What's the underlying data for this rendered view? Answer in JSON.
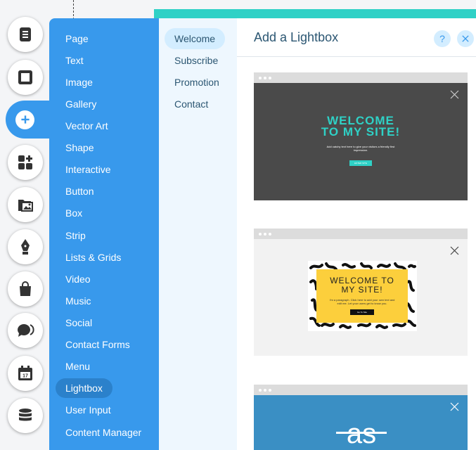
{
  "colors": {
    "accent": "#3899ec",
    "active_item": "#2b81cb",
    "teal": "#2fd1c6",
    "text_dark": "#2b5672"
  },
  "rail": {
    "items": [
      {
        "icon": "pages-icon"
      },
      {
        "icon": "background-icon"
      },
      {
        "icon": "add-icon",
        "active": true
      },
      {
        "icon": "app-market-icon"
      },
      {
        "icon": "media-icon"
      },
      {
        "icon": "blog-pen-icon"
      },
      {
        "icon": "store-bag-icon"
      },
      {
        "icon": "chat-icon"
      },
      {
        "icon": "bookings-calendar-icon"
      },
      {
        "icon": "database-icon"
      }
    ]
  },
  "categories": [
    "Page",
    "Text",
    "Image",
    "Gallery",
    "Vector Art",
    "Shape",
    "Interactive",
    "Button",
    "Box",
    "Strip",
    "Lists & Grids",
    "Video",
    "Music",
    "Social",
    "Contact Forms",
    "Menu",
    "Lightbox",
    "User Input",
    "Content Manager"
  ],
  "active_category": "Lightbox",
  "subcategories": [
    "Welcome",
    "Subscribe",
    "Promotion",
    "Contact"
  ],
  "active_subcategory": "Welcome",
  "content": {
    "title": "Add a Lightbox",
    "help_label": "?",
    "thumbnails": [
      {
        "heading_line1": "WELCOME",
        "heading_line2": "TO MY SITE!",
        "paragraph": "Add catchy text here to give your visitors a friendly first impression.",
        "button": "ENTER SITE"
      },
      {
        "heading_line1": "WELCOME TO",
        "heading_line2": "MY SITE!",
        "paragraph": "I'm a paragraph. Click here to add your own text and edit me. Let your users get to know you.",
        "button": "Go To Site"
      },
      {
        "logo_text": "as"
      }
    ]
  }
}
